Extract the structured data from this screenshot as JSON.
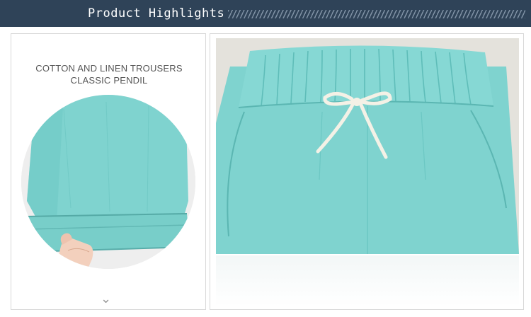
{
  "header": {
    "title": "Product Highlights"
  },
  "left_panel": {
    "caption_line1": "COTTON AND LINEN TROUSERS",
    "caption_line2": "CLASSIC PENDIL",
    "scroll_icon": "chevron-down-icon"
  },
  "right_panel": {
    "image": "trousers-waistband-drawstring-photo"
  },
  "colors": {
    "header_bg": "#2f4358",
    "fabric": "#7fd3cf",
    "fabric_shadow": "#5fbdb9",
    "drawstring": "#f4f1e6"
  }
}
